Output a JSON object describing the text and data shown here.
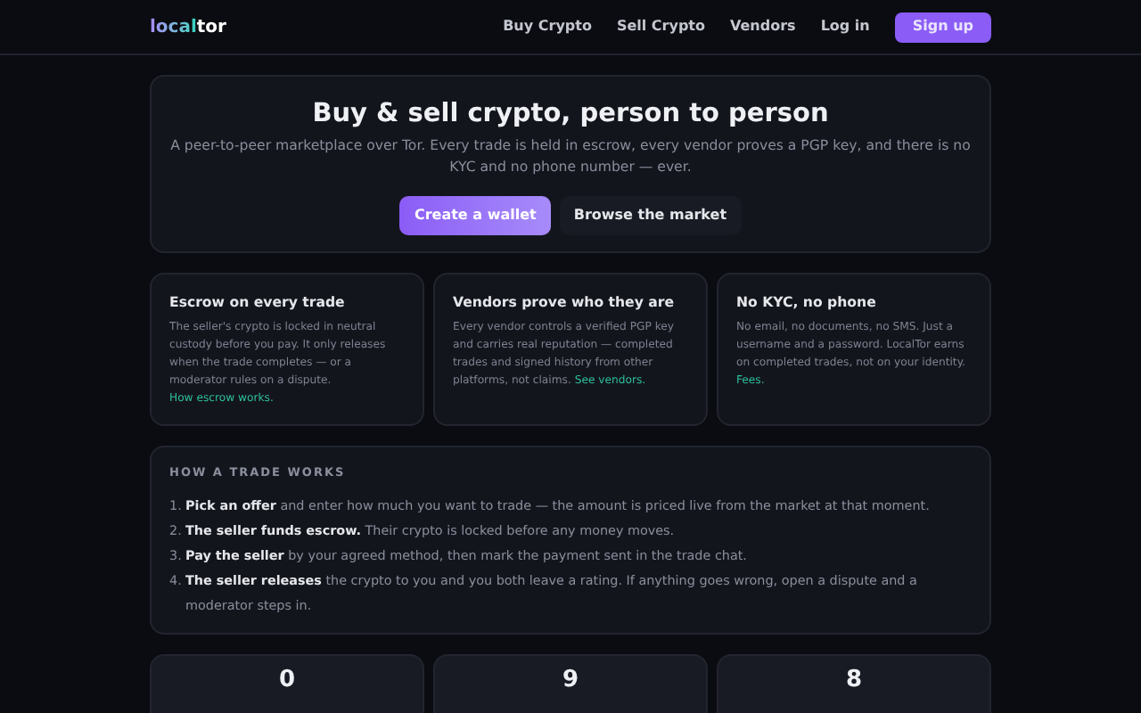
{
  "nav": {
    "logo": {
      "accent": "local",
      "rest": "tor"
    },
    "links": [
      "Buy Crypto",
      "Sell Crypto",
      "Vendors",
      "Log in"
    ],
    "signup": "Sign up"
  },
  "hero": {
    "title": "Buy & sell crypto, person to person",
    "subtitle": "A peer-to-peer marketplace over Tor. Every trade is held in escrow, every vendor proves a PGP key, and there is no KYC and no phone number — ever.",
    "buttons": [
      {
        "label": "Create a wallet",
        "kind": "primary"
      },
      {
        "label": "Browse the market",
        "kind": "secondary"
      }
    ]
  },
  "features": [
    {
      "title": "Escrow on every trade",
      "text": "The seller's crypto is locked in neutral custody before you pay. It only releases when the trade completes — or a moderator rules on a dispute.",
      "link": "How escrow works."
    },
    {
      "title": "Vendors prove who they are",
      "text": "Every vendor controls a verified PGP key and carries real reputation — completed trades and signed history from other platforms, not claims.",
      "link": "See vendors."
    },
    {
      "title": "No KYC, no phone",
      "text": "No email, no documents, no SMS. Just a username and a password. LocalTor earns on completed trades, not on your identity.",
      "link": "Fees."
    }
  ],
  "how": {
    "heading": "HOW A TRADE WORKS",
    "steps": [
      {
        "number": "1.",
        "text": "**Pick an offer** and enter how much you want to trade — the amount is priced live from the market at that moment."
      },
      {
        "number": "2.",
        "text": "**The seller funds escrow.** Their crypto is locked before any money moves."
      },
      {
        "number": "3.",
        "text": "**Pay the seller** by your agreed method, then mark the payment sent in the trade chat."
      },
      {
        "number": "4.",
        "text": "**The seller releases** the crypto to you and you both leave a rating. If anything goes wrong, open a dispute and a moderator steps in."
      }
    ]
  },
  "stats": [
    "0",
    "9",
    "8"
  ]
}
